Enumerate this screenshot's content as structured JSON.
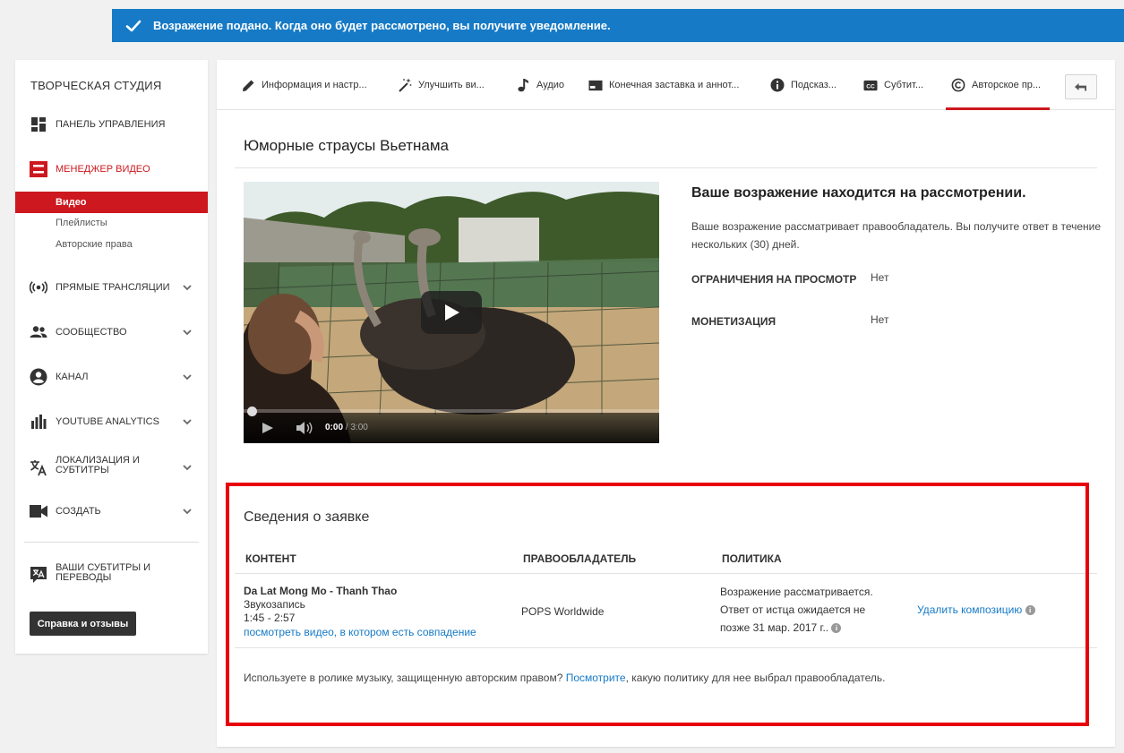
{
  "notice": {
    "text": "Возражение подано. Когда оно будет рассмотрено, вы получите уведомление."
  },
  "sidebar": {
    "title": "ТВОРЧЕСКАЯ СТУДИЯ",
    "dashboard": "ПАНЕЛЬ УПРАВЛЕНИЯ",
    "video_manager": "МЕНЕДЖЕР ВИДЕО",
    "sub_items": [
      "Видео",
      "Плейлисты",
      "Авторские права"
    ],
    "live": "ПРЯМЫЕ ТРАНСЛЯЦИИ",
    "community": "СООБЩЕСТВО",
    "channel": "КАНАЛ",
    "analytics": "YOUTUBE ANALYTICS",
    "localization_1": "ЛОКАЛИЗАЦИЯ И",
    "localization_2": "СУБТИТРЫ",
    "create": "СОЗДАТЬ",
    "subtitles_1": "ВАШИ СУБТИТРЫ И",
    "subtitles_2": "ПЕРЕВОДЫ",
    "help_button": "Справка и отзывы"
  },
  "tabs": [
    "Информация и настр...",
    "Улучшить ви...",
    "Аудио",
    "Конечная заставка и аннот...",
    "Подсказ...",
    "Субтит...",
    "Авторское пр..."
  ],
  "video": {
    "title": "Юморные страусы Вьетнама",
    "current_time": "0:00",
    "duration": "/ 3:00",
    "progress": 0
  },
  "review": {
    "heading": "Ваше возражение находится на рассмотрении.",
    "text": "Ваше возражение рассматривает правообладатель. Вы получите ответ в течение нескольких (30) дней.",
    "restrictions_label": "ОГРАНИЧЕНИЯ НА ПРОСМОТР",
    "restrictions_value": "Нет",
    "monetization_label": "МОНЕТИЗАЦИЯ",
    "monetization_value": "Нет"
  },
  "claim": {
    "title": "Сведения о заявке",
    "headers": {
      "content": "КОНТЕНТ",
      "owner": "ПРАВООБЛАДАТЕЛЬ",
      "policy": "ПОЛИТИКА"
    },
    "row": {
      "song": "Da Lat Mong Mo - Thanh Thao",
      "type": "Звукозапись",
      "range": "1:45 - 2:57",
      "match_link": "посмотреть видео, в котором есть совпадение",
      "owner": "POPS Worldwide",
      "policy_1": "Возражение рассматривается.",
      "policy_2": "Ответ от истца ожидается не",
      "policy_3": "позже 31 мар. 2017 г..",
      "remove_link": "Удалить композицию"
    },
    "footer_before": "Используете в ролике музыку, защищенную авторским правом? ",
    "footer_link": "Посмотрите",
    "footer_after": ", какую политику для нее выбрал правообладатель."
  },
  "colors": {
    "accent": "#cc181e",
    "notice": "#167ac6",
    "highlight_box": "#e8000b",
    "link": "#167ac6"
  }
}
